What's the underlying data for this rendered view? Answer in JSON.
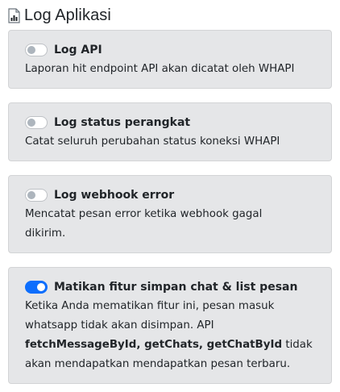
{
  "header": {
    "title": "Log Aplikasi",
    "icon": "chart-file-icon"
  },
  "colors": {
    "card_bg": "#e5e6e8",
    "switch_on": "#0d6efd",
    "switch_off_knob": "#adb5bd",
    "text": "#212529"
  },
  "settings": [
    {
      "label": "Log API",
      "enabled": false,
      "description": "Laporan hit endpoint API akan dicatat oleh WHAPI"
    },
    {
      "label": "Log status perangkat",
      "enabled": false,
      "description": "Catat seluruh perubahan status koneksi WHAPI"
    },
    {
      "label": "Log webhook error",
      "enabled": false,
      "description": "Mencatat pesan error ketika webhook gagal dikirim."
    },
    {
      "label": "Matikan fitur simpan chat & list pesan",
      "enabled": true,
      "description_prefix": "Ketika Anda mematikan fitur ini, pesan masuk whatsapp tidak akan disimpan. API",
      "description_bold": "fetchMessageById, getChats, getChatById",
      "description_suffix": "tidak akan mendapatkan mendapatkan pesan terbaru."
    }
  ]
}
